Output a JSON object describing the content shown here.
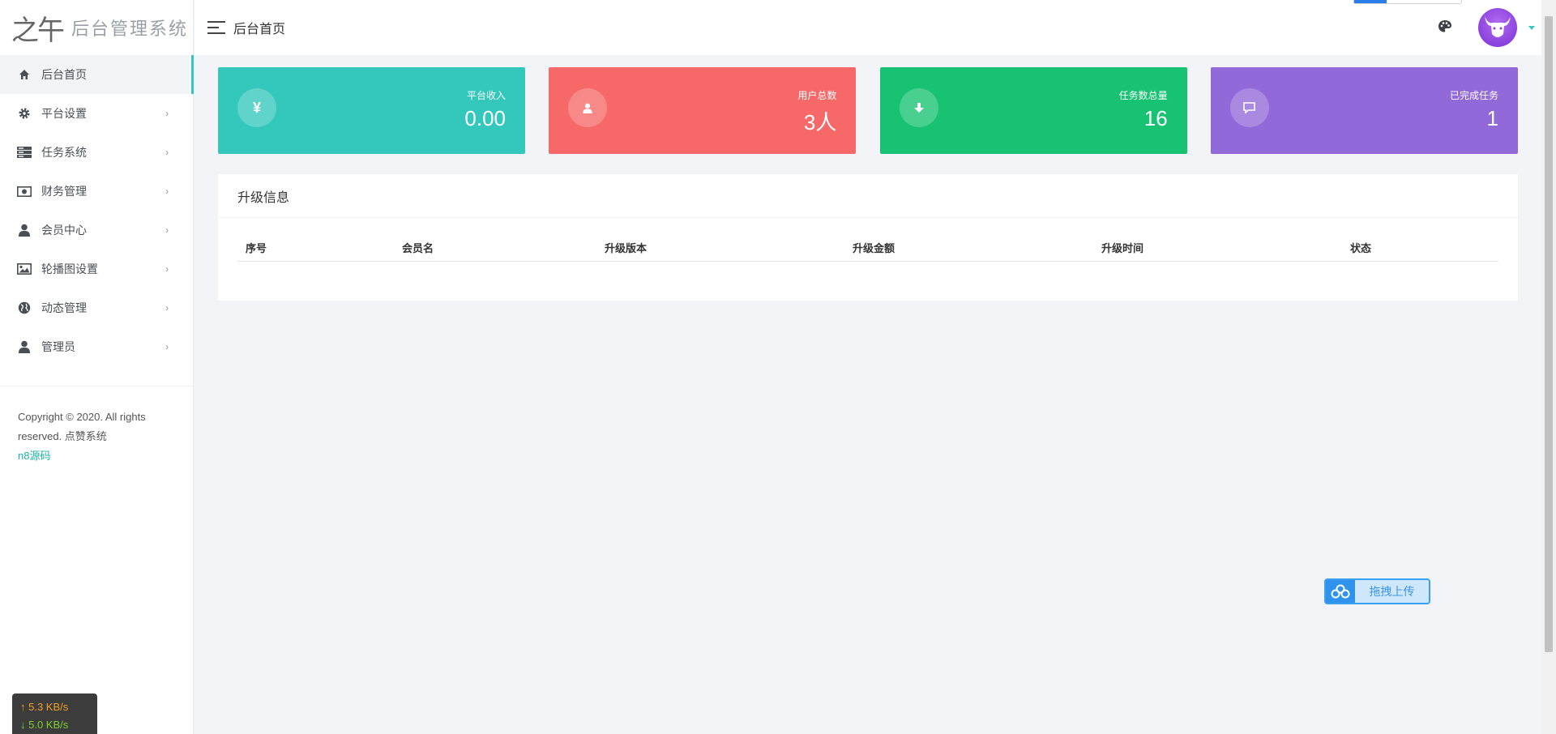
{
  "logo": {
    "mark": "之午",
    "title": "后台管理系统"
  },
  "sidebar": {
    "items": [
      {
        "label": "后台首页",
        "icon": "home-icon",
        "active": true
      },
      {
        "label": "平台设置",
        "icon": "gear-icon"
      },
      {
        "label": "任务系统",
        "icon": "server-icon"
      },
      {
        "label": "财务管理",
        "icon": "money-icon"
      },
      {
        "label": "会员中心",
        "icon": "user-icon"
      },
      {
        "label": "轮播图设置",
        "icon": "image-icon"
      },
      {
        "label": "动态管理",
        "icon": "globe-icon"
      },
      {
        "label": "管理员",
        "icon": "user-icon"
      }
    ],
    "chevron": "›",
    "copyright_line1": "Copyright © 2020. All rights",
    "copyright_line2": "reserved. 点赞系统",
    "brand": "n8源码"
  },
  "speed": {
    "up": "↑ 5.3 KB/s",
    "down": "↓ 5.0 KB/s"
  },
  "header": {
    "title": "后台首页"
  },
  "cards": [
    {
      "label": "平台收入",
      "value": "0.00",
      "icon": "yen-icon",
      "symbol": "¥",
      "color": "#34c8bd"
    },
    {
      "label": "用户总数",
      "value": "3人",
      "icon": "user-icon",
      "symbol": "",
      "color": "#f76868"
    },
    {
      "label": "任务数总量",
      "value": "16",
      "icon": "download-icon",
      "symbol": "",
      "color": "#17c372"
    },
    {
      "label": "已完成任务",
      "value": "1",
      "icon": "comment-icon",
      "symbol": "",
      "color": "#9269d8"
    }
  ],
  "panel": {
    "title": "升级信息",
    "columns": [
      "序号",
      "会员名",
      "升级版本",
      "升级金额",
      "升级时间",
      "状态"
    ]
  },
  "upload": {
    "label": "拖拽上传"
  }
}
